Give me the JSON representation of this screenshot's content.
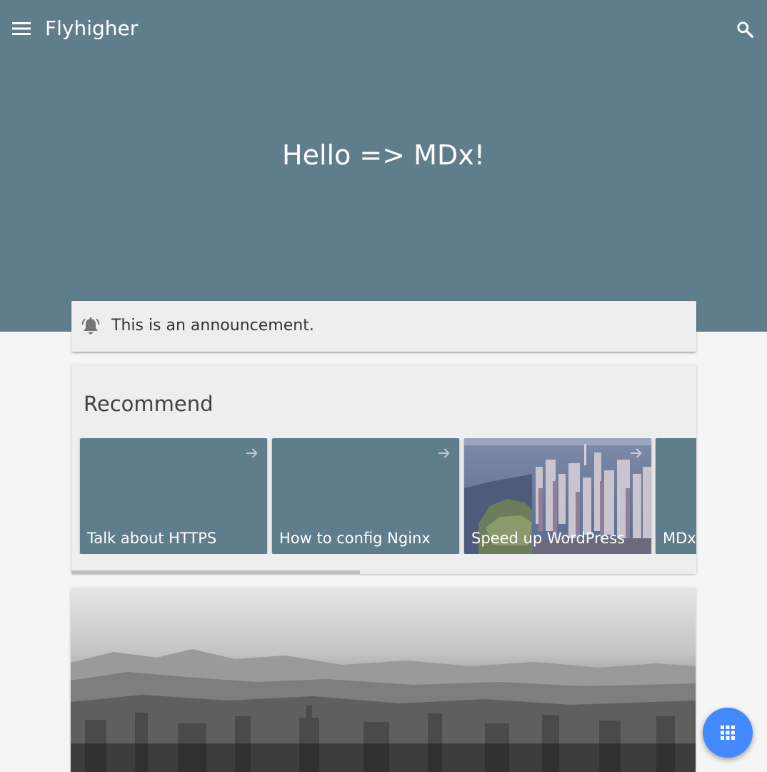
{
  "app": {
    "site_title": "Flyhigher"
  },
  "icons": {
    "menu": "menu-icon",
    "search": "search-icon",
    "bell": "bell-ring-icon",
    "arrow": "arrow-forward-icon",
    "apps": "apps-grid-icon"
  },
  "colors": {
    "primary": "#607d8b",
    "accent": "#448aff",
    "card_background": "#eeeeee",
    "page_background": "#f5f5f5"
  },
  "hero": {
    "title": "Hello => MDx!"
  },
  "announcement": {
    "text": "This is an announcement."
  },
  "recommend": {
    "title": "Recommend",
    "items": [
      {
        "label": "Talk about HTTPS",
        "has_image": false
      },
      {
        "label": "How to config Nginx",
        "has_image": false
      },
      {
        "label": "Speed up WordPress",
        "has_image": true
      },
      {
        "label": "MDx",
        "has_image": false
      }
    ],
    "scroll_fraction": 0.46
  }
}
